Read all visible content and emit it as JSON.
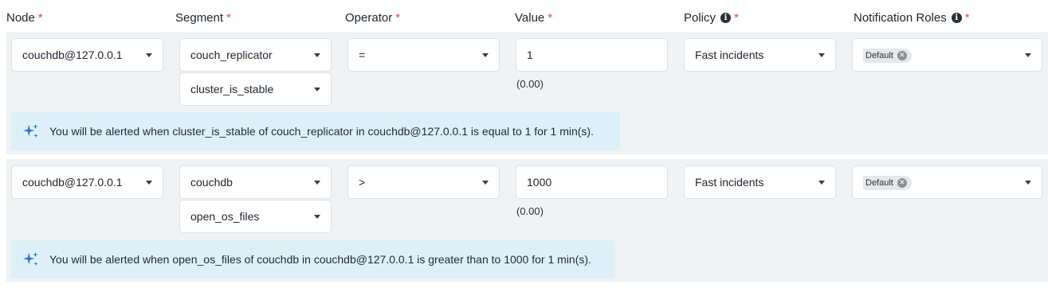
{
  "headers": {
    "node": "Node",
    "segment": "Segment",
    "operator": "Operator",
    "value": "Value",
    "policy": "Policy",
    "notification_roles": "Notification Roles",
    "required_mark": "*"
  },
  "rules": [
    {
      "node": "couchdb@127.0.0.1",
      "segment": "couch_replicator",
      "sub_segment": "cluster_is_stable",
      "operator": "=",
      "value": "1",
      "value_hint": "(0.00)",
      "policy": "Fast incidents",
      "role_tag": "Default",
      "alert": "You will be alerted when cluster_is_stable of couch_replicator in couchdb@127.0.0.1 is equal to 1 for 1 min(s)."
    },
    {
      "node": "couchdb@127.0.0.1",
      "segment": "couchdb",
      "sub_segment": "open_os_files",
      "operator": ">",
      "value": "1000",
      "value_hint": "(0.00)",
      "policy": "Fast incidents",
      "role_tag": "Default",
      "alert": "You will be alerted when open_os_files of couchdb in couchdb@127.0.0.1 is greater than to 1000 for 1 min(s)."
    }
  ],
  "icons": {
    "dropdown": "chevron-down-icon",
    "info": "info-icon",
    "sparkle": "sparkle-icon",
    "tag_remove": "remove-tag-icon"
  },
  "colors": {
    "row_bg": "#eff3f5",
    "alert_bg": "#ddf0f8",
    "sparkle": "#2e74c9",
    "required": "#e5484d"
  }
}
